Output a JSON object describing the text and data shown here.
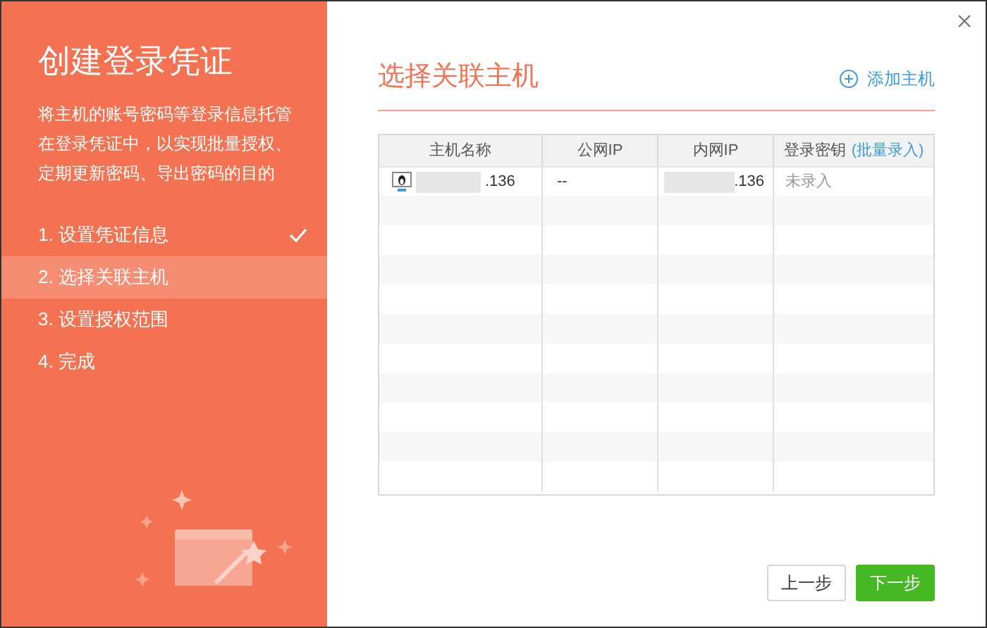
{
  "sidebar": {
    "title": "创建登录凭证",
    "description": "将主机的账号密码等登录信息托管在登录凭证中，以实现批量授权、定期更新密码、导出密码的目的",
    "steps": [
      {
        "label": "1. 设置凭证信息",
        "completed": true,
        "selected": false
      },
      {
        "label": "2. 选择关联主机",
        "completed": false,
        "selected": true
      },
      {
        "label": "3. 设置授权范围",
        "completed": false,
        "selected": false
      },
      {
        "label": "4. 完成",
        "completed": false,
        "selected": false
      }
    ]
  },
  "panel": {
    "title": "选择关联主机",
    "add_link": "添加主机"
  },
  "table": {
    "columns": [
      "主机名称",
      "公网IP",
      "内网IP",
      "登录密钥"
    ],
    "batch_link": "(批量录入)",
    "rows": [
      {
        "host_name": ".136",
        "public_ip": "--",
        "private_ip": ".136",
        "login_key": "未录入"
      }
    ]
  },
  "buttons": {
    "prev": "上一步",
    "next": "下一步"
  }
}
